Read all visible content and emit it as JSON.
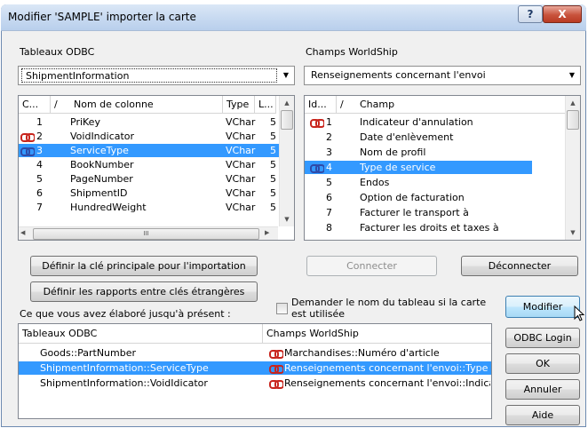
{
  "window": {
    "title": "Modifier 'SAMPLE' importer la carte",
    "help_glyph": "?",
    "close_glyph": "X"
  },
  "left": {
    "section_label": "Tableaux ODBC",
    "combo_value": "ShipmentInformation",
    "columns": [
      "C...",
      "/",
      "Nom de colonne",
      "Type",
      "L..."
    ],
    "sort_glyph": "▲",
    "rows": [
      {
        "num": "1",
        "name": "PriKey",
        "type": "VChar",
        "len": "5",
        "link": "",
        "selected": false
      },
      {
        "num": "2",
        "name": "VoidIndicator",
        "type": "VChar",
        "len": "5",
        "link": "red",
        "selected": false
      },
      {
        "num": "3",
        "name": "ServiceType",
        "type": "VChar",
        "len": "5",
        "link": "blue",
        "selected": true
      },
      {
        "num": "4",
        "name": "BookNumber",
        "type": "VChar",
        "len": "5",
        "link": "",
        "selected": false
      },
      {
        "num": "5",
        "name": "PageNumber",
        "type": "VChar",
        "len": "5",
        "link": "",
        "selected": false
      },
      {
        "num": "6",
        "name": "ShipmentID",
        "type": "VChar",
        "len": "5",
        "link": "",
        "selected": false
      },
      {
        "num": "7",
        "name": "HundredWeight",
        "type": "VChar",
        "len": "5",
        "link": "",
        "selected": false
      }
    ],
    "hscroll_grip": "III"
  },
  "right": {
    "section_label": "Champs WorldShip",
    "combo_value": "Renseignements concernant l'envoi",
    "columns": [
      "Id...",
      "/",
      "Champ"
    ],
    "rows": [
      {
        "num": "1",
        "name": "Indicateur d'annulation",
        "link": "red",
        "selected": false
      },
      {
        "num": "2",
        "name": "Date d'enlèvement",
        "link": "",
        "selected": false
      },
      {
        "num": "3",
        "name": "Nom de profil",
        "link": "",
        "selected": false
      },
      {
        "num": "4",
        "name": "Type de service",
        "link": "blue",
        "selected": true
      },
      {
        "num": "5",
        "name": "Endos",
        "link": "",
        "selected": false
      },
      {
        "num": "6",
        "name": "Option de facturation",
        "link": "",
        "selected": false
      },
      {
        "num": "7",
        "name": "Facturer le transport à",
        "link": "",
        "selected": false
      },
      {
        "num": "8",
        "name": "Facturer les droits et taxes à",
        "link": "",
        "selected": false
      }
    ]
  },
  "buttons": {
    "define_primary_key": "Définir la clé principale pour l'importation",
    "define_foreign_keys": "Définir les rapports entre clés étrangères",
    "connect": "Connecter",
    "disconnect": "Déconnecter",
    "modify": "Modifier",
    "odbc_login": "ODBC Login",
    "ok": "OK",
    "cancel": "Annuler",
    "help": "Aide"
  },
  "ask_table_name": {
    "label": "Demander le nom du tableau si la carte est utilisée",
    "checked": false
  },
  "summary": {
    "label": "Ce que vous avez élaboré jusqu'à présent :",
    "col_left": "Tableaux ODBC",
    "col_right": "Champs WorldShip",
    "rows": [
      {
        "left": "Goods::PartNumber",
        "right": "Marchandises::Numéro d'article",
        "selected": false
      },
      {
        "left": "ShipmentInformation::ServiceType",
        "right": "Renseignements concernant l'envoi::Type d...",
        "selected": true
      },
      {
        "left": "ShipmentInformation::VoidIdicator",
        "right": "Renseignements concernant l'envoi::Indicate...",
        "selected": false
      }
    ]
  },
  "colors": {
    "selection": "#3399ff",
    "link_red": "#c8251d",
    "link_blue": "#2e4aa8"
  }
}
